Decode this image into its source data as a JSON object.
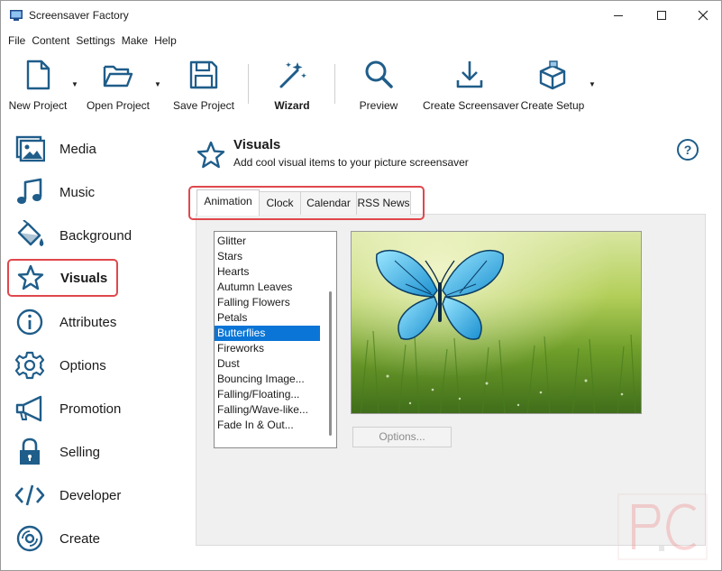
{
  "window": {
    "title": "Screensaver Factory"
  },
  "menu": [
    "File",
    "Content",
    "Settings",
    "Make",
    "Help"
  ],
  "toolbar": {
    "new_project": "New Project",
    "open_project": "Open Project",
    "save_project": "Save Project",
    "wizard": "Wizard",
    "preview": "Preview",
    "create_screensaver": "Create Screensaver",
    "create_setup": "Create Setup"
  },
  "sidebar": {
    "items": [
      {
        "label": "Media",
        "icon": "media-icon"
      },
      {
        "label": "Music",
        "icon": "music-icon"
      },
      {
        "label": "Background",
        "icon": "background-icon"
      },
      {
        "label": "Visuals",
        "icon": "star-icon"
      },
      {
        "label": "Attributes",
        "icon": "info-icon"
      },
      {
        "label": "Options",
        "icon": "gear-icon"
      },
      {
        "label": "Promotion",
        "icon": "megaphone-icon"
      },
      {
        "label": "Selling",
        "icon": "lock-icon"
      },
      {
        "label": "Developer",
        "icon": "code-icon"
      },
      {
        "label": "Create",
        "icon": "disc-icon"
      }
    ],
    "active": "Visuals"
  },
  "header": {
    "title": "Visuals",
    "subtitle": "Add cool visual items to your picture screensaver",
    "help": "?"
  },
  "tabs": [
    "Animation",
    "Clock",
    "Calendar",
    "RSS News"
  ],
  "active_tab": "Animation",
  "animations": {
    "items": [
      "Glitter",
      "Stars",
      "Hearts",
      "Autumn Leaves",
      "Falling Flowers",
      "Petals",
      "Butterflies",
      "Fireworks",
      "Dust",
      "Bouncing Image...",
      "Falling/Floating...",
      "Falling/Wave-like...",
      "Fade In & Out..."
    ],
    "selected": "Butterflies"
  },
  "options_button": "Options...",
  "colors": {
    "accent_red": "#e0474c",
    "selection_blue": "#0a75d6",
    "icon_blue": "#1f5d8a"
  }
}
